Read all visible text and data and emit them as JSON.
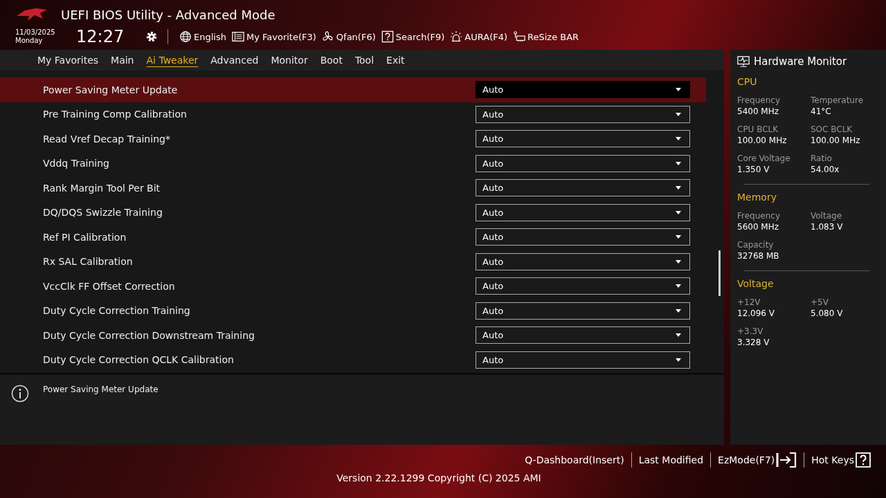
{
  "window": {
    "title": "UEFI BIOS Utility - Advanced Mode"
  },
  "date": "11/03/2025",
  "day": "Monday",
  "time": "12:27",
  "toolbar": [
    {
      "kind": "globe",
      "label": "English"
    },
    {
      "kind": "favorite",
      "label": "My Favorite(F3)"
    },
    {
      "kind": "fan",
      "label": "Qfan(F6)"
    },
    {
      "kind": "help",
      "label": "Search(F9)"
    },
    {
      "kind": "aura",
      "label": "AURA(F4)"
    },
    {
      "kind": "bar",
      "label": "ReSize BAR"
    }
  ],
  "tabs": [
    {
      "label": "My Favorites",
      "selected": false
    },
    {
      "label": "Main",
      "selected": false
    },
    {
      "label": "Ai Tweaker",
      "selected": true
    },
    {
      "label": "Advanced",
      "selected": false
    },
    {
      "label": "Monitor",
      "selected": false
    },
    {
      "label": "Boot",
      "selected": false
    },
    {
      "label": "Tool",
      "selected": false
    },
    {
      "label": "Exit",
      "selected": false
    }
  ],
  "settings": [
    {
      "label": "Power Saving Meter Update",
      "value": "Auto",
      "selected": true
    },
    {
      "label": "Pre Training Comp Calibration",
      "value": "Auto",
      "selected": false
    },
    {
      "label": "Read Vref Decap Training*",
      "value": "Auto",
      "selected": false
    },
    {
      "label": "Vddq Training",
      "value": "Auto",
      "selected": false
    },
    {
      "label": "Rank Margin Tool Per Bit",
      "value": "Auto",
      "selected": false
    },
    {
      "label": "DQ/DQS Swizzle Training",
      "value": "Auto",
      "selected": false
    },
    {
      "label": "Ref PI Calibration",
      "value": "Auto",
      "selected": false
    },
    {
      "label": "Rx SAL Calibration",
      "value": "Auto",
      "selected": false
    },
    {
      "label": "VccClk FF Offset Correction",
      "value": "Auto",
      "selected": false
    },
    {
      "label": "Duty Cycle Correction Training",
      "value": "Auto",
      "selected": false
    },
    {
      "label": "Duty Cycle Correction Downstream Training",
      "value": "Auto",
      "selected": false
    },
    {
      "label": "Duty Cycle Correction QCLK Calibration",
      "value": "Auto",
      "selected": false
    }
  ],
  "help": {
    "text": "Power Saving Meter Update"
  },
  "hardware_monitor": {
    "title": "Hardware Monitor",
    "sections": [
      {
        "title": "CPU",
        "items": [
          {
            "label": "Frequency",
            "value": "5400 MHz"
          },
          {
            "label": "Temperature",
            "value": "41°C"
          },
          {
            "label": "CPU BCLK",
            "value": "100.00 MHz"
          },
          {
            "label": "SOC BCLK",
            "value": "100.00 MHz"
          },
          {
            "label": "Core Voltage",
            "value": "1.350 V"
          },
          {
            "label": "Ratio",
            "value": "54.00x"
          }
        ]
      },
      {
        "title": "Memory",
        "items": [
          {
            "label": "Frequency",
            "value": "5600 MHz"
          },
          {
            "label": "Voltage",
            "value": "1.083 V"
          },
          {
            "label": "Capacity",
            "value": "32768 MB"
          }
        ]
      },
      {
        "title": "Voltage",
        "items": [
          {
            "label": "+12V",
            "value": "12.096 V"
          },
          {
            "label": "+5V",
            "value": "5.080 V"
          },
          {
            "label": "+3.3V",
            "value": "3.328 V"
          }
        ]
      }
    ]
  },
  "footer": {
    "links": [
      {
        "kind": "plain",
        "label": "Q-Dashboard(Insert)"
      },
      {
        "kind": "plain",
        "label": "Last Modified"
      },
      {
        "kind": "exit",
        "label": "EzMode(F7)"
      },
      {
        "kind": "help",
        "label": "Hot Keys"
      }
    ],
    "version": "Version 2.22.1299 Copyright (C) 2025 AMI"
  }
}
